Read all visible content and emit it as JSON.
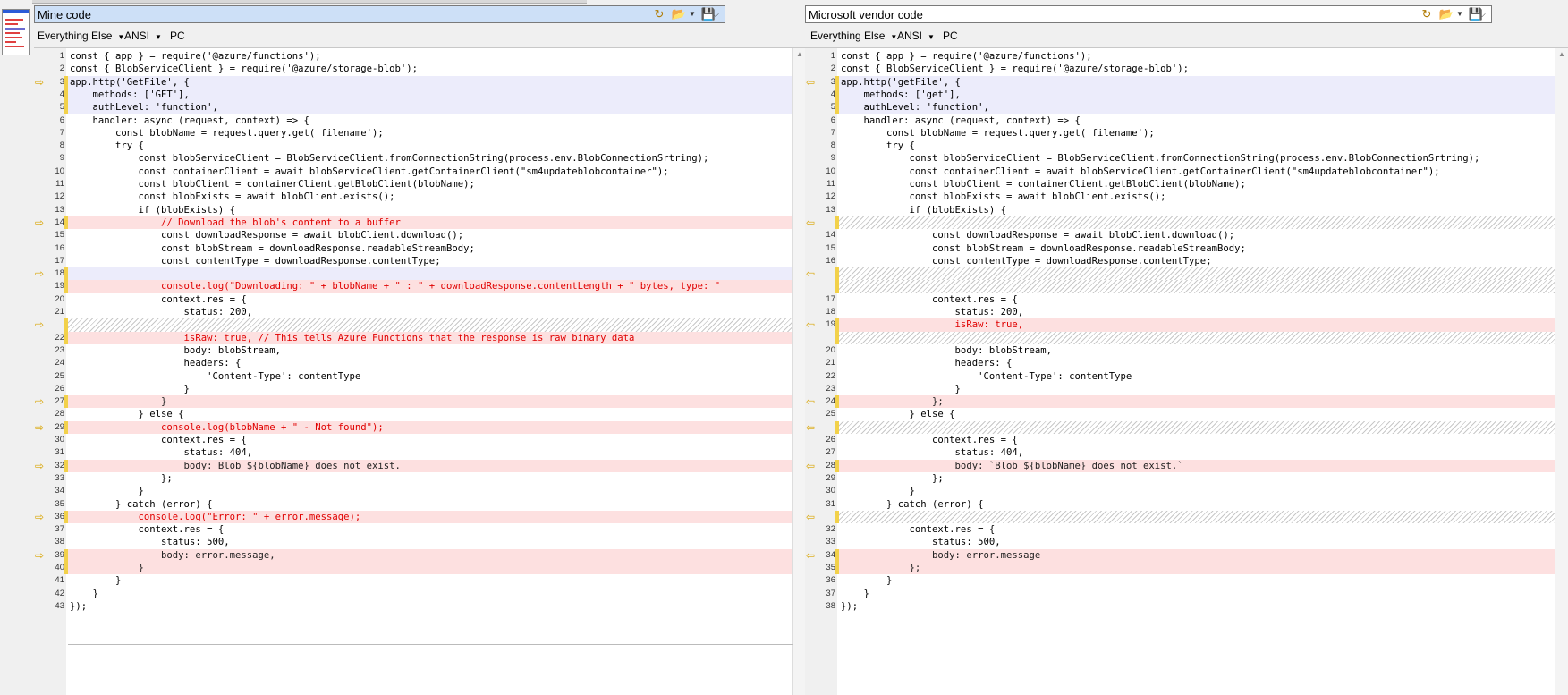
{
  "left": {
    "path": "Mine code",
    "format": {
      "type": "Everything Else",
      "encoding": "ANSI",
      "eol": "PC"
    },
    "rows": [
      {
        "n": "1",
        "t": "const { app } = require('@azure/functions');",
        "s": "n"
      },
      {
        "n": "2",
        "t": "const { BlobServiceClient } = require('@azure/storage-blob');",
        "s": "n"
      },
      {
        "n": "3",
        "t": "app.http('GetFile', {",
        "s": "b",
        "a": true
      },
      {
        "n": "4",
        "t": "    methods: ['GET'],",
        "s": "b"
      },
      {
        "n": "5",
        "t": "    authLevel: 'function',",
        "s": "b"
      },
      {
        "n": "6",
        "t": "    handler: async (request, context) => {",
        "s": "n"
      },
      {
        "n": "7",
        "t": "        const blobName = request.query.get('filename');",
        "s": "n"
      },
      {
        "n": "8",
        "t": "        try {",
        "s": "n"
      },
      {
        "n": "9",
        "t": "            const blobServiceClient = BlobServiceClient.fromConnectionString(process.env.BlobConnectionSrtring);",
        "s": "n"
      },
      {
        "n": "10",
        "t": "            const containerClient = await blobServiceClient.getContainerClient(\"sm4updateblobcontainer\");",
        "s": "n"
      },
      {
        "n": "11",
        "t": "            const blobClient = containerClient.getBlobClient(blobName);",
        "s": "n"
      },
      {
        "n": "12",
        "t": "            const blobExists = await blobClient.exists();",
        "s": "n"
      },
      {
        "n": "13",
        "t": "            if (blobExists) {",
        "s": "n"
      },
      {
        "n": "14",
        "t": "                // Download the blob's content to a buffer",
        "s": "r",
        "a": true
      },
      {
        "n": "15",
        "t": "                const downloadResponse = await blobClient.download();",
        "s": "n"
      },
      {
        "n": "16",
        "t": "                const blobStream = downloadResponse.readableStreamBody;",
        "s": "n"
      },
      {
        "n": "17",
        "t": "                const contentType = downloadResponse.contentType;",
        "s": "n"
      },
      {
        "n": "18",
        "t": "",
        "s": "b",
        "a": true
      },
      {
        "n": "19",
        "t": "                console.log(\"Downloading: \" + blobName + \" : \" + downloadResponse.contentLength + \" bytes, type: \"",
        "s": "r"
      },
      {
        "n": "20",
        "t": "                context.res = {",
        "s": "n"
      },
      {
        "n": "21",
        "t": "                    status: 200,",
        "s": "n"
      },
      {
        "n": "",
        "t": "",
        "s": "h",
        "a": true
      },
      {
        "n": "22",
        "t": "                    isRaw: true, // This tells Azure Functions that the response is raw binary data",
        "s": "r"
      },
      {
        "n": "23",
        "t": "                    body: blobStream,",
        "s": "n"
      },
      {
        "n": "24",
        "t": "                    headers: {",
        "s": "n"
      },
      {
        "n": "25",
        "t": "                        'Content-Type': contentType",
        "s": "n"
      },
      {
        "n": "26",
        "t": "                    }",
        "s": "n"
      },
      {
        "n": "27",
        "t": "                }",
        "s": "d",
        "a": true
      },
      {
        "n": "28",
        "t": "            } else {",
        "s": "n"
      },
      {
        "n": "29",
        "t": "                console.log(blobName + \" - Not found\");",
        "s": "r",
        "a": true
      },
      {
        "n": "30",
        "t": "                context.res = {",
        "s": "n"
      },
      {
        "n": "31",
        "t": "                    status: 404,",
        "s": "n"
      },
      {
        "n": "32",
        "t": "                    body: Blob ${blobName} does not exist.",
        "s": "d",
        "a": true
      },
      {
        "n": "33",
        "t": "                };",
        "s": "n"
      },
      {
        "n": "34",
        "t": "            }",
        "s": "n"
      },
      {
        "n": "35",
        "t": "        } catch (error) {",
        "s": "n"
      },
      {
        "n": "36",
        "t": "            console.log(\"Error: \" + error.message);",
        "s": "r",
        "a": true
      },
      {
        "n": "37",
        "t": "            context.res = {",
        "s": "n"
      },
      {
        "n": "38",
        "t": "                status: 500,",
        "s": "n"
      },
      {
        "n": "39",
        "t": "                body: error.message,",
        "s": "d",
        "a": true
      },
      {
        "n": "40",
        "t": "            }",
        "s": "d"
      },
      {
        "n": "41",
        "t": "        }",
        "s": "n"
      },
      {
        "n": "42",
        "t": "    }",
        "s": "n"
      },
      {
        "n": "43",
        "t": "});",
        "s": "n"
      }
    ]
  },
  "right": {
    "path": "Microsoft vendor code",
    "format": {
      "type": "Everything Else",
      "encoding": "ANSI",
      "eol": "PC"
    },
    "rows": [
      {
        "n": "1",
        "t": "const { app } = require('@azure/functions');",
        "s": "n"
      },
      {
        "n": "2",
        "t": "const { BlobServiceClient } = require('@azure/storage-blob');",
        "s": "n"
      },
      {
        "n": "3",
        "t": "app.http('getFile', {",
        "s": "b",
        "a": true
      },
      {
        "n": "4",
        "t": "    methods: ['get'],",
        "s": "b"
      },
      {
        "n": "5",
        "t": "    authLevel: 'function',",
        "s": "b"
      },
      {
        "n": "6",
        "t": "    handler: async (request, context) => {",
        "s": "n"
      },
      {
        "n": "7",
        "t": "        const blobName = request.query.get('filename');",
        "s": "n"
      },
      {
        "n": "8",
        "t": "        try {",
        "s": "n"
      },
      {
        "n": "9",
        "t": "            const blobServiceClient = BlobServiceClient.fromConnectionString(process.env.BlobConnectionSrtring);",
        "s": "n"
      },
      {
        "n": "10",
        "t": "            const containerClient = await blobServiceClient.getContainerClient(\"sm4updateblobcontainer\");",
        "s": "n"
      },
      {
        "n": "11",
        "t": "            const blobClient = containerClient.getBlobClient(blobName);",
        "s": "n"
      },
      {
        "n": "12",
        "t": "            const blobExists = await blobClient.exists();",
        "s": "n"
      },
      {
        "n": "13",
        "t": "            if (blobExists) {",
        "s": "n"
      },
      {
        "n": "",
        "t": "",
        "s": "h",
        "a": true
      },
      {
        "n": "14",
        "t": "                const downloadResponse = await blobClient.download();",
        "s": "n"
      },
      {
        "n": "15",
        "t": "                const blobStream = downloadResponse.readableStreamBody;",
        "s": "n"
      },
      {
        "n": "16",
        "t": "                const contentType = downloadResponse.contentType;",
        "s": "n"
      },
      {
        "n": "",
        "t": "",
        "s": "h",
        "a": true
      },
      {
        "n": "",
        "t": "",
        "s": "h"
      },
      {
        "n": "17",
        "t": "                context.res = {",
        "s": "n"
      },
      {
        "n": "18",
        "t": "                    status: 200,",
        "s": "n"
      },
      {
        "n": "19",
        "t": "                    isRaw: true,",
        "s": "r",
        "a": true
      },
      {
        "n": "",
        "t": "",
        "s": "h"
      },
      {
        "n": "20",
        "t": "                    body: blobStream,",
        "s": "n"
      },
      {
        "n": "21",
        "t": "                    headers: {",
        "s": "n"
      },
      {
        "n": "22",
        "t": "                        'Content-Type': contentType",
        "s": "n"
      },
      {
        "n": "23",
        "t": "                    }",
        "s": "n"
      },
      {
        "n": "24",
        "t": "                };",
        "s": "d",
        "a": true
      },
      {
        "n": "25",
        "t": "            } else {",
        "s": "n"
      },
      {
        "n": "",
        "t": "",
        "s": "h",
        "a": true
      },
      {
        "n": "26",
        "t": "                context.res = {",
        "s": "n"
      },
      {
        "n": "27",
        "t": "                    status: 404,",
        "s": "n"
      },
      {
        "n": "28",
        "t": "                    body: `Blob ${blobName} does not exist.`",
        "s": "d",
        "a": true
      },
      {
        "n": "29",
        "t": "                };",
        "s": "n"
      },
      {
        "n": "30",
        "t": "            }",
        "s": "n"
      },
      {
        "n": "31",
        "t": "        } catch (error) {",
        "s": "n"
      },
      {
        "n": "",
        "t": "",
        "s": "h",
        "a": true
      },
      {
        "n": "32",
        "t": "            context.res = {",
        "s": "n"
      },
      {
        "n": "33",
        "t": "                status: 500,",
        "s": "n"
      },
      {
        "n": "34",
        "t": "                body: error.message",
        "s": "d",
        "a": true
      },
      {
        "n": "35",
        "t": "            };",
        "s": "d"
      },
      {
        "n": "36",
        "t": "        }",
        "s": "n"
      },
      {
        "n": "37",
        "t": "    }",
        "s": "n"
      },
      {
        "n": "38",
        "t": "});",
        "s": "n"
      }
    ]
  },
  "icons": {
    "left_arrow": "right-arrow-icon",
    "right_arrow": "left-arrow-icon",
    "open": "open-folder-icon",
    "reload": "reload-icon",
    "save": "save-icon"
  },
  "colors": {
    "diff_bg": "#fde0e0",
    "similar_bg": "#ececfb",
    "change_bar": "#f2d14a",
    "arrow": "#d9a400",
    "path_selected_bg": "#cde0f7"
  }
}
